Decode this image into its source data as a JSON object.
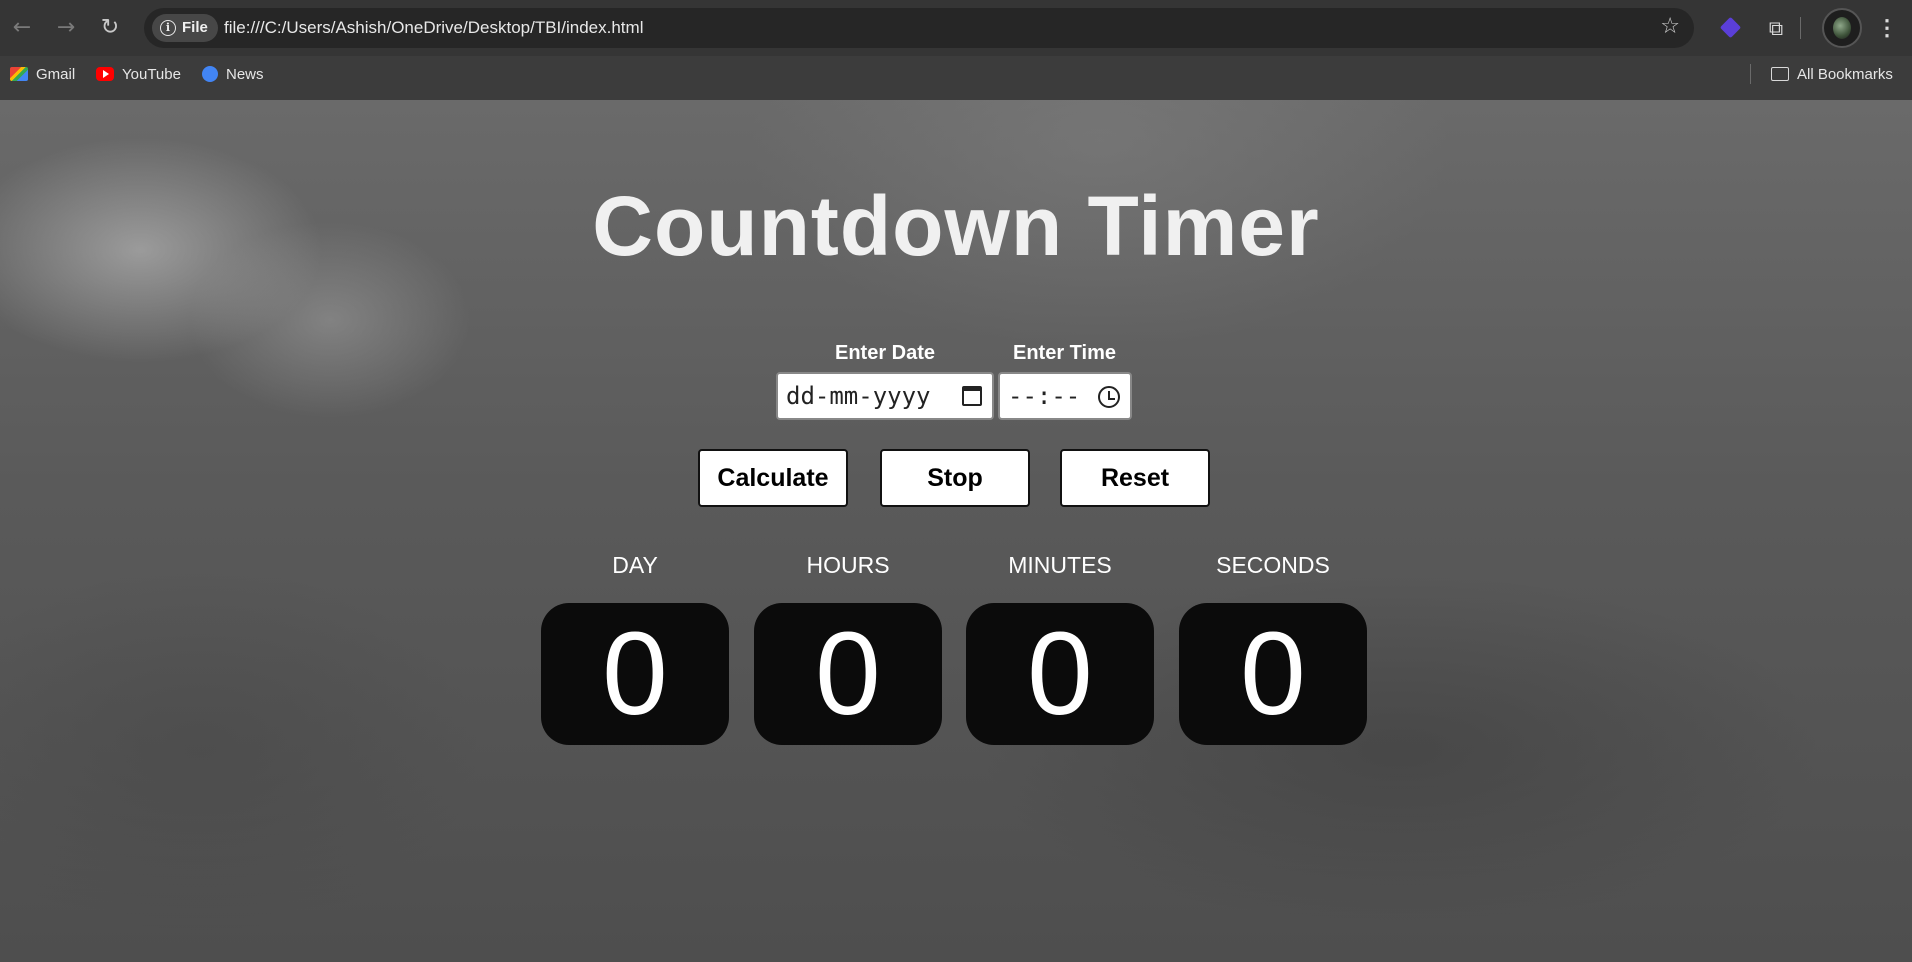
{
  "browser": {
    "chip_label": "File",
    "url": "file:///C:/Users/Ashish/OneDrive/Desktop/TBI/index.html",
    "icons": [
      "back-arrow-icon",
      "forward-arrow-icon",
      "reload-icon",
      "info-icon",
      "star-icon",
      "extension-icon",
      "puzzle-icon",
      "avatar",
      "menu-icon"
    ],
    "bookmarks": [
      {
        "label": "Gmail",
        "icon": "gmail-icon"
      },
      {
        "label": "YouTube",
        "icon": "youtube-icon"
      },
      {
        "label": "News",
        "icon": "news-icon"
      }
    ],
    "all_bookmarks": "All Bookmarks"
  },
  "page": {
    "title": "Countdown Timer",
    "date_label": "Enter Date",
    "time_label": "Enter Time",
    "date_placeholder": "dd-mm-yyyy",
    "time_placeholder": "--:--",
    "buttons": {
      "calculate": "Calculate",
      "stop": "Stop",
      "reset": "Reset"
    },
    "units": [
      {
        "label": "DAY",
        "value": "0"
      },
      {
        "label": "HOURS",
        "value": "0"
      },
      {
        "label": "MINUTES",
        "value": "0"
      },
      {
        "label": "SECONDS",
        "value": "0"
      }
    ]
  }
}
